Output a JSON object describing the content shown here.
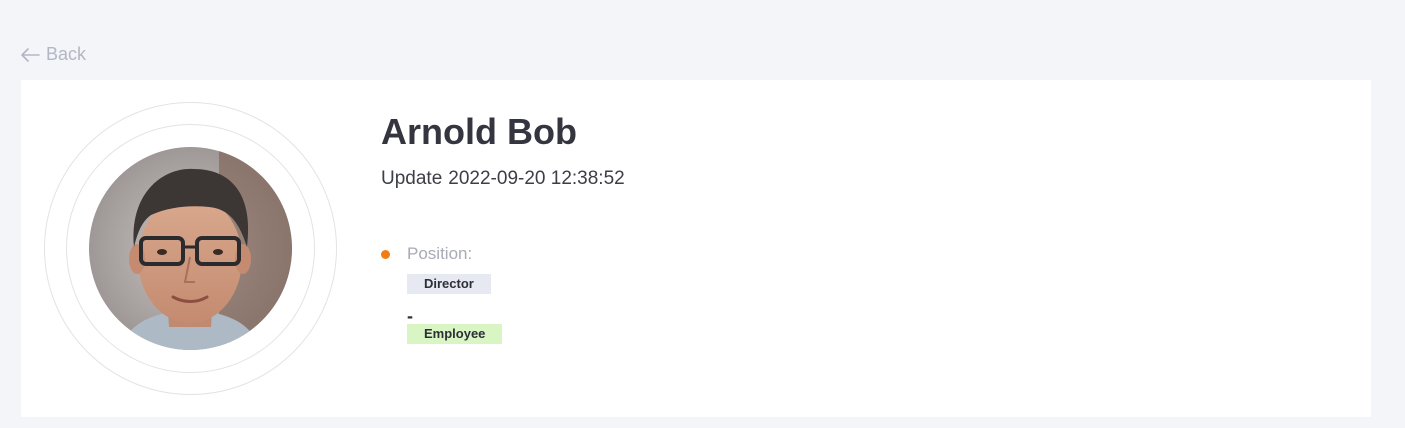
{
  "nav": {
    "back_label": "Back",
    "back_icon": "arrow-left-icon"
  },
  "profile": {
    "name": "Arnold Bob",
    "update_label": "Update",
    "update_time": "2022-09-20 12:38:52",
    "avatar_icon": "user-avatar-photo"
  },
  "position": {
    "label": "Position:",
    "bullet_color": "#f07c12",
    "roles": [
      {
        "label": "Director",
        "bg_color": "#e6e8f2"
      },
      {
        "label": "Employee",
        "bg_color": "#d9f5c4"
      }
    ],
    "separator": "-"
  }
}
